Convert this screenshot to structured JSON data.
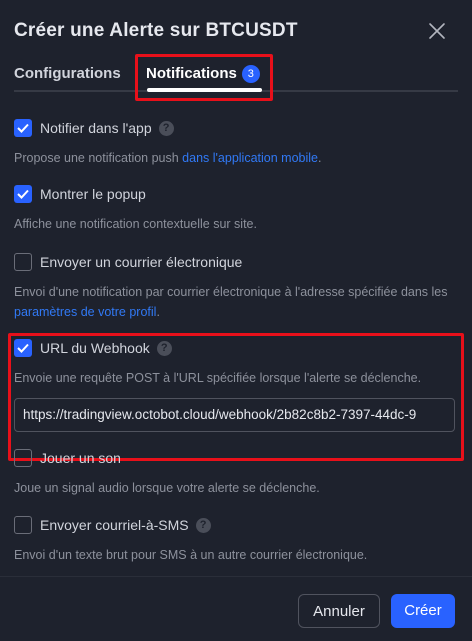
{
  "dialog": {
    "title": "Créer une Alerte sur BTCUSDT"
  },
  "tabs": {
    "configurations": "Configurations",
    "notifications": "Notifications",
    "notifications_badge": "3"
  },
  "options": {
    "app": {
      "label": "Notifier dans l'app",
      "checked": true,
      "desc_pre": "Propose une notification push ",
      "desc_link": "dans l'application mobile",
      "desc_post": "."
    },
    "popup": {
      "label": "Montrer le popup",
      "checked": true,
      "desc": "Affiche une notification contextuelle sur site."
    },
    "email": {
      "label": "Envoyer un courrier électronique",
      "checked": false,
      "desc_pre": "Envoi d'une notification par courrier électronique à l'adresse spécifiée dans les ",
      "desc_link": "paramètres de votre profil",
      "desc_post": "."
    },
    "webhook": {
      "label": "URL du Webhook",
      "checked": true,
      "desc": "Envoie une requête POST à l'URL spécifiée lorsque l'alerte se déclenche.",
      "url": "https://tradingview.octobot.cloud/webhook/2b82c8b2-7397-44dc-9"
    },
    "sound": {
      "label": "Jouer un son",
      "checked": false,
      "desc": "Joue un signal audio lorsque votre alerte se déclenche."
    },
    "sms": {
      "label": "Envoyer courriel-à-SMS",
      "checked": false,
      "desc": "Envoi d'un texte brut pour SMS à un autre courrier électronique."
    }
  },
  "footer": {
    "cancel": "Annuler",
    "create": "Créer"
  },
  "colors": {
    "accent": "#2962ff",
    "highlight": "#e8101a",
    "background": "#1e222d"
  }
}
